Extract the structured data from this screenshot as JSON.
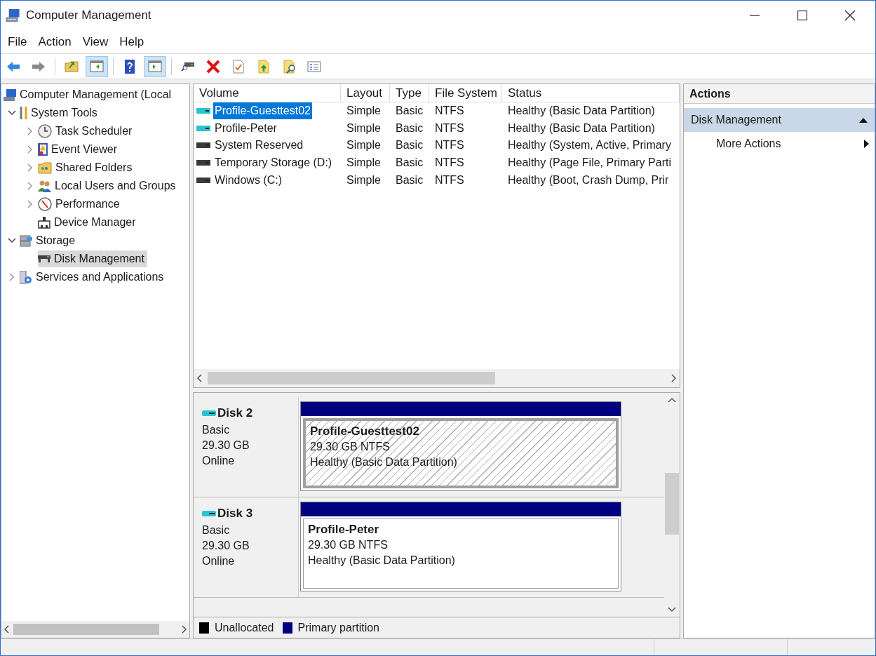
{
  "window": {
    "title": "Computer Management"
  },
  "menu": [
    "File",
    "Action",
    "View",
    "Help"
  ],
  "toolbar": [
    [
      {
        "pressed": false
      },
      {
        "pressed": false
      }
    ],
    [
      {
        "pressed": false
      },
      {
        "pressed": true
      }
    ],
    [
      {
        "pressed": false
      },
      {
        "pressed": true
      }
    ],
    [
      {
        "pressed": false
      },
      {
        "pressed": false
      },
      {
        "pressed": false
      },
      {
        "pressed": false
      },
      {
        "pressed": false
      },
      {
        "pressed": false
      }
    ]
  ],
  "tree": [
    {
      "label": "Computer Management (Local",
      "selected": false,
      "children": [
        {
          "label": "System Tools",
          "expanded": true,
          "selected": false,
          "children": [
            {
              "label": "Task Scheduler",
              "expanded": false,
              "selected": false
            },
            {
              "label": "Event Viewer",
              "expanded": false,
              "selected": false
            },
            {
              "label": "Shared Folders",
              "expanded": false,
              "selected": false
            },
            {
              "label": "Local Users and Groups",
              "expanded": false,
              "selected": false
            },
            {
              "label": "Performance",
              "expanded": false,
              "selected": false
            },
            {
              "label": "Device Manager",
              "selected": false
            }
          ]
        },
        {
          "label": "Storage",
          "expanded": true,
          "selected": false,
          "children": [
            {
              "label": "Disk Management",
              "selected": true
            }
          ]
        },
        {
          "label": "Services and Applications",
          "expanded": false,
          "selected": false
        }
      ]
    }
  ],
  "volumes": {
    "columns": [
      "Volume",
      "Layout",
      "Type",
      "File System",
      "Status"
    ],
    "rows": [
      {
        "cells": [
          "Profile-Guesttest02",
          "Simple",
          "Basic",
          "NTFS",
          "Healthy (Basic Data Partition)"
        ],
        "color": "#27c4d0",
        "selected": true
      },
      {
        "cells": [
          "Profile-Peter",
          "Simple",
          "Basic",
          "NTFS",
          "Healthy (Basic Data Partition)"
        ],
        "color": "#27c4d0",
        "selected": false
      },
      {
        "cells": [
          "System Reserved",
          "Simple",
          "Basic",
          "NTFS",
          "Healthy (System, Active, Primary"
        ],
        "color": "#3a3a3a",
        "selected": false
      },
      {
        "cells": [
          "Temporary Storage (D:)",
          "Simple",
          "Basic",
          "NTFS",
          "Healthy (Page File, Primary Parti"
        ],
        "color": "#3a3a3a",
        "selected": false
      },
      {
        "cells": [
          "Windows (C:)",
          "Simple",
          "Basic",
          "NTFS",
          "Healthy (Boot, Crash Dump, Prir"
        ],
        "color": "#3a3a3a",
        "selected": false
      }
    ]
  },
  "disks": [
    {
      "name": "Disk 2",
      "type": "Basic",
      "size": "29.30 GB",
      "state": "Online",
      "partition": {
        "name": "Profile-Guesttest02",
        "size": "29.30 GB NTFS",
        "status": "Healthy (Basic Data Partition)",
        "selected": true
      }
    },
    {
      "name": "Disk 3",
      "type": "Basic",
      "size": "29.30 GB",
      "state": "Online",
      "partition": {
        "name": "Profile-Peter",
        "size": "29.30 GB NTFS",
        "status": "Healthy (Basic Data Partition)",
        "selected": false
      }
    }
  ],
  "legend": [
    {
      "label": "Unallocated",
      "color": "#000000"
    },
    {
      "label": "Primary partition",
      "color": "#000080"
    }
  ],
  "actions": {
    "title": "Actions",
    "section": "Disk Management",
    "items": [
      "More Actions"
    ]
  }
}
